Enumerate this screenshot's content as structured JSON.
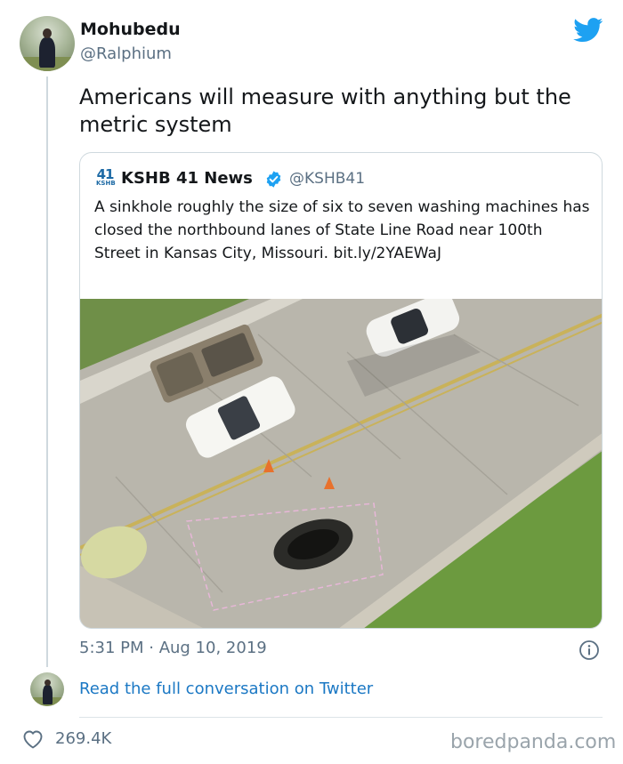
{
  "author": {
    "name": "Mohubedu",
    "handle": "@Ralphium"
  },
  "tweet": {
    "text": "Americans will measure with anything but the metric system"
  },
  "quoted": {
    "logo_number": "41",
    "logo_letters": "KSHB",
    "name": "KSHB 41 News",
    "handle": "@KSHB41",
    "text": "A sinkhole roughly the size of six to seven washing machines has closed the northbound lanes of State Line Road near 100th Street in Kansas City, Missouri. bit.ly/2YAEWaJ"
  },
  "meta": {
    "timestamp": "5:31 PM · Aug 10, 2019",
    "read_more_label": "Read the full conversation on Twitter",
    "likes": "269.4K"
  },
  "watermark": "boredpanda.com",
  "colors": {
    "twitter_blue": "#1da1f2",
    "link_blue": "#1b78c4",
    "secondary_text": "#5b7083",
    "verified_blue": "#1da1f2"
  },
  "icons": {
    "brand": "twitter-bird-icon",
    "verified": "verified-badge-icon",
    "info": "info-icon",
    "like": "heart-icon"
  }
}
